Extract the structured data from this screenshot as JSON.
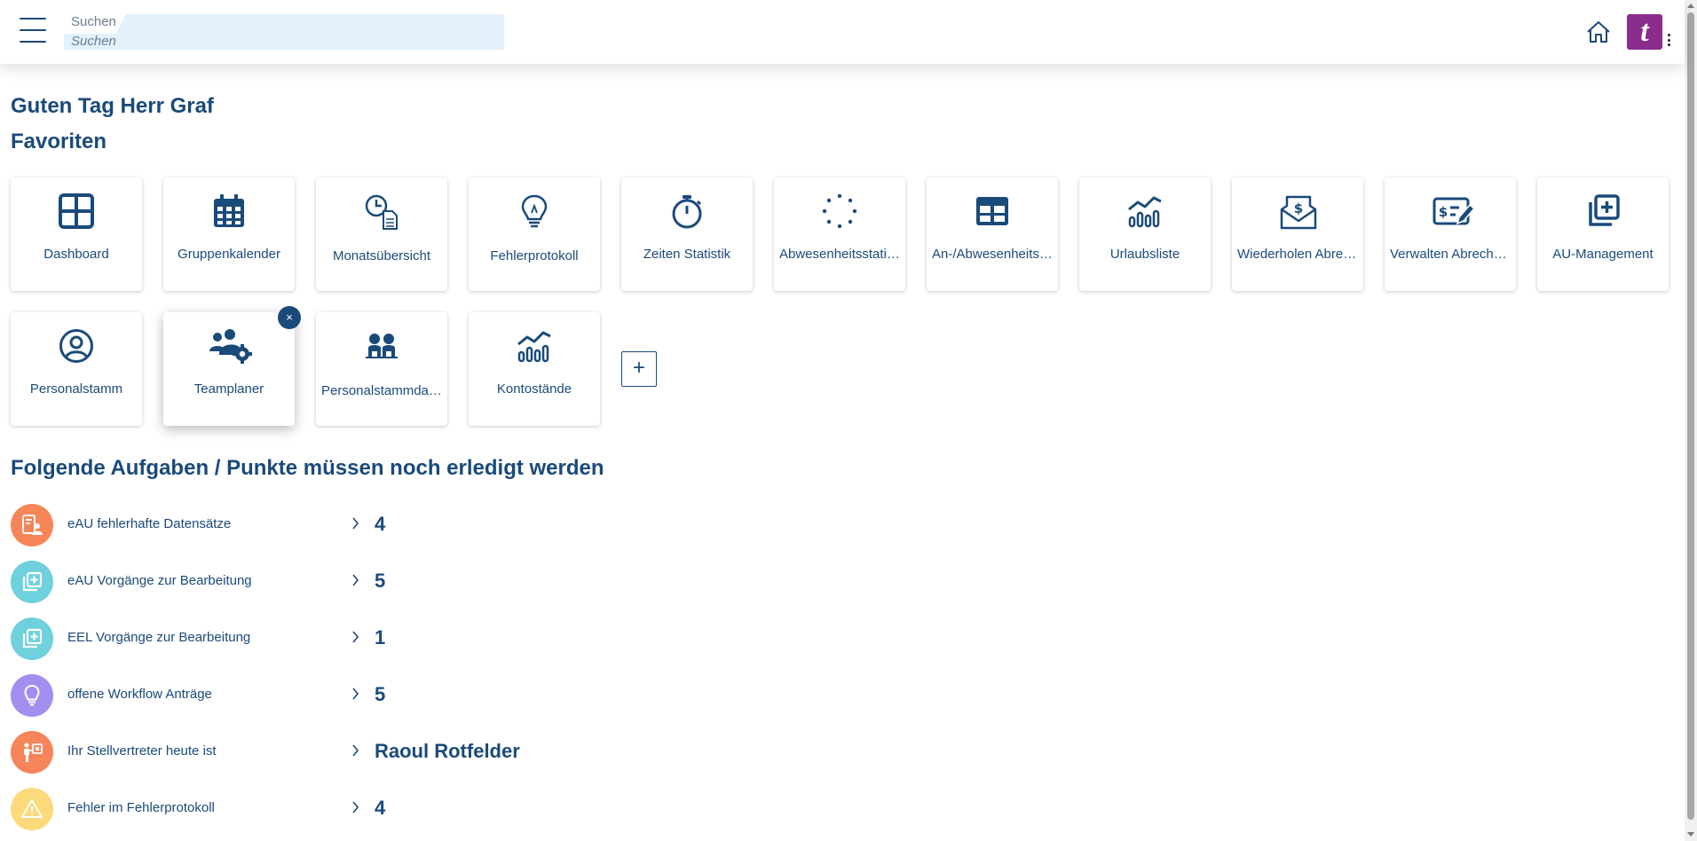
{
  "header": {
    "search_label": "Suchen",
    "search_placeholder": "Suchen",
    "logo_letter": "t",
    "colors": {
      "accent": "#1a4a7a",
      "logo_bg": "#8a2c8c",
      "search_bg": "#e3f1fd"
    }
  },
  "greeting": "Guten Tag Herr Graf",
  "favorites": {
    "title": "Favoriten",
    "tiles": [
      {
        "label": "Dashboard",
        "icon": "dashboard-grid-icon"
      },
      {
        "label": "Gruppenkalender",
        "icon": "calendar-icon"
      },
      {
        "label": "Monatsübersicht",
        "icon": "clock-document-icon"
      },
      {
        "label": "Fehlerprotokoll",
        "icon": "lightbulb-icon"
      },
      {
        "label": "Zeiten Statistik",
        "icon": "stopwatch-icon"
      },
      {
        "label": "Abwesenheitsstatistik",
        "icon": "dotted-circle-icon"
      },
      {
        "label": "An-/Abwesenheitsübersicht",
        "icon": "table-icon"
      },
      {
        "label": "Urlaubsliste",
        "icon": "bar-line-chart-icon"
      },
      {
        "label": "Wiederholen Abrechnung",
        "icon": "dollar-envelope-icon"
      },
      {
        "label": "Verwalten Abrechnung",
        "icon": "dollar-check-pen-icon"
      },
      {
        "label": "AU-Management",
        "icon": "stacked-plus-icon"
      },
      {
        "label": "Personalstamm",
        "icon": "user-circle-icon"
      },
      {
        "label": "Teamplaner",
        "icon": "team-gear-icon"
      },
      {
        "label": "Personalstammdaten",
        "icon": "two-persons-icon"
      },
      {
        "label": "Kontostände",
        "icon": "bar-line-chart-icon"
      }
    ],
    "remove_symbol": "×",
    "add_symbol": "+"
  },
  "tasks": {
    "title": "Folgende Aufgaben / Punkte müssen noch erledigt werden",
    "items": [
      {
        "label": "eAU fehlerhafte Datensätze",
        "value": "4",
        "icon": "id-card-icon",
        "color": "#f7855a"
      },
      {
        "label": "eAU Vorgänge zur Bearbeitung",
        "value": "5",
        "icon": "stacked-plus-icon",
        "color": "#6fd0de"
      },
      {
        "label": "EEL Vorgänge zur Bearbeitung",
        "value": "1",
        "icon": "stacked-plus-icon",
        "color": "#6fd0de"
      },
      {
        "label": "offene Workflow Anträge",
        "value": "5",
        "icon": "lightbulb-icon",
        "color": "#a38ef0"
      },
      {
        "label": "Ihr Stellvertreter heute ist",
        "value": "Raoul Rotfelder",
        "icon": "person-board-icon",
        "color": "#f7855a"
      },
      {
        "label": "Fehler im Fehlerprotokoll",
        "value": "4",
        "icon": "warning-icon",
        "color": "#fcd97a"
      }
    ]
  }
}
